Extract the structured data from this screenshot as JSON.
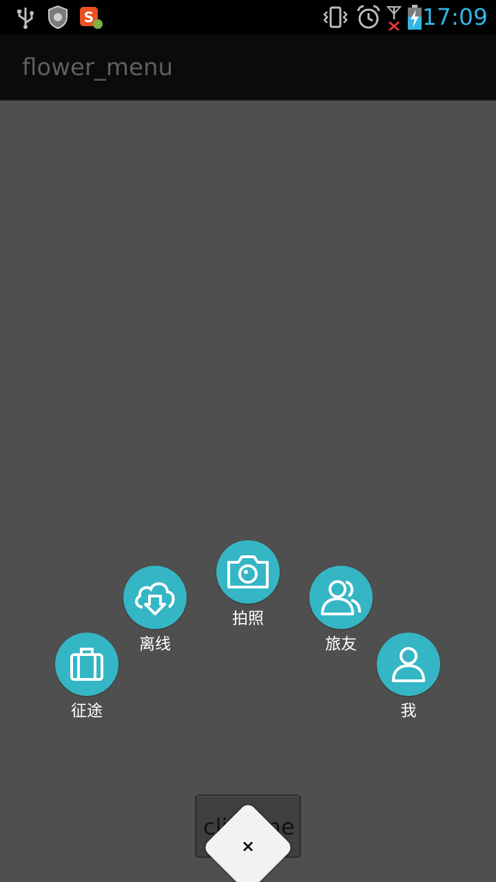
{
  "status_bar": {
    "time": "17:09",
    "icons": [
      "usb-icon",
      "shield-app-icon",
      "sogou-app-icon",
      "vibrate-icon",
      "alarm-icon",
      "signal-no-service-icon",
      "battery-charging-icon"
    ]
  },
  "action_bar": {
    "title": "flower_menu"
  },
  "flower_menu": {
    "items": [
      {
        "label": "征途",
        "icon": "luggage-icon"
      },
      {
        "label": "离线",
        "icon": "cloud-download-icon"
      },
      {
        "label": "拍照",
        "icon": "camera-icon"
      },
      {
        "label": "旅友",
        "icon": "group-icon"
      },
      {
        "label": "我",
        "icon": "person-icon"
      }
    ],
    "accent_color": "#35b6c4"
  },
  "bottom": {
    "button_label": "click me",
    "close_symbol": "×"
  }
}
